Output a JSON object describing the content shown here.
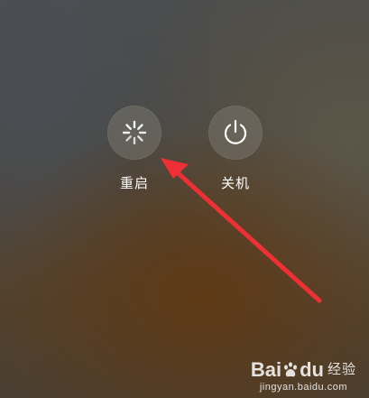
{
  "power_menu": {
    "reboot": {
      "label": "重启",
      "icon": "spinner-icon"
    },
    "shutdown": {
      "label": "关机",
      "icon": "power-icon"
    }
  },
  "watermark": {
    "brand_left": "Bai",
    "brand_right": "du",
    "brand_cn": "经验",
    "domain": "jingyan.baidu.com"
  },
  "colors": {
    "arrow": "#ee2f36",
    "button_fill": "#78746c",
    "label_text": "#ffffff"
  }
}
